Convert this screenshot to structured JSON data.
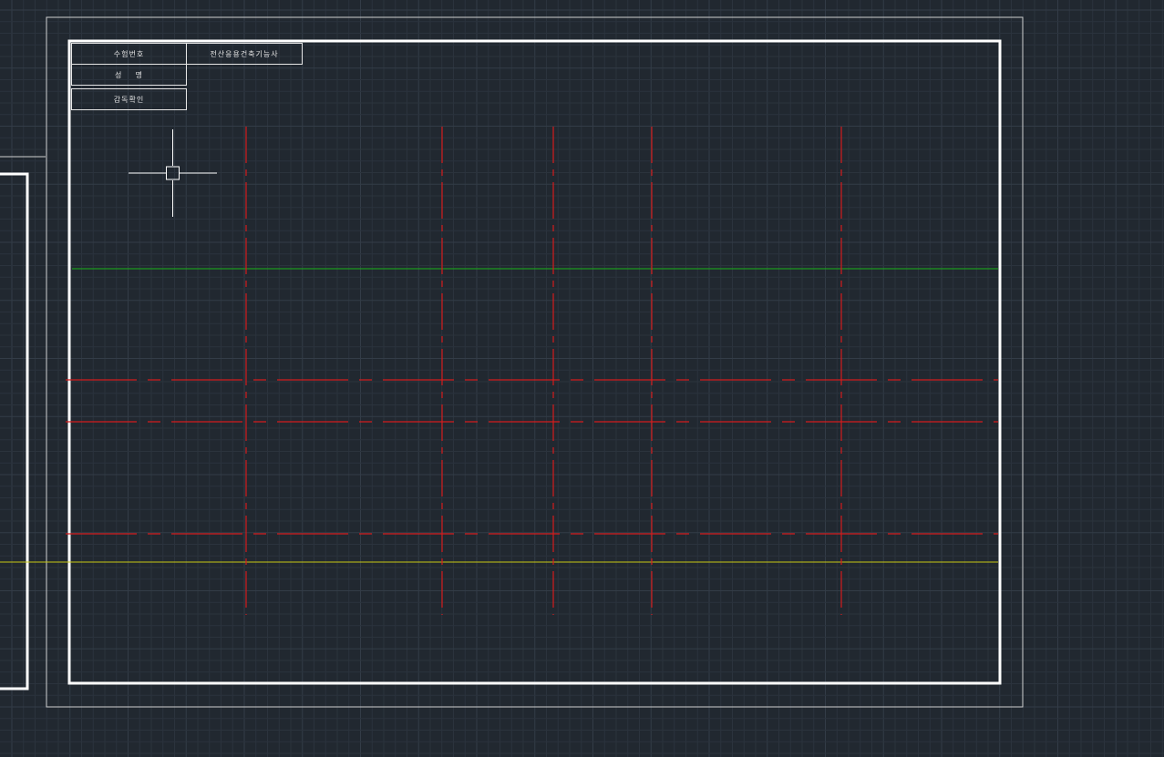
{
  "viewport": {
    "background": "#212830",
    "grid_color": "#2b333d",
    "grid_major_color": "#333c47"
  },
  "title_block": {
    "exam_number_label": "수험번호",
    "exam_title": "전산응용건축기능사",
    "name_label": "성    명",
    "supervisor_label": "감독확인"
  },
  "colors": {
    "sheet_border": "#ffffff",
    "axis_lines": "#d41c1c",
    "green_line": "#19b319",
    "yellow_line": "#c8c814",
    "crosshair": "#ffffff"
  }
}
